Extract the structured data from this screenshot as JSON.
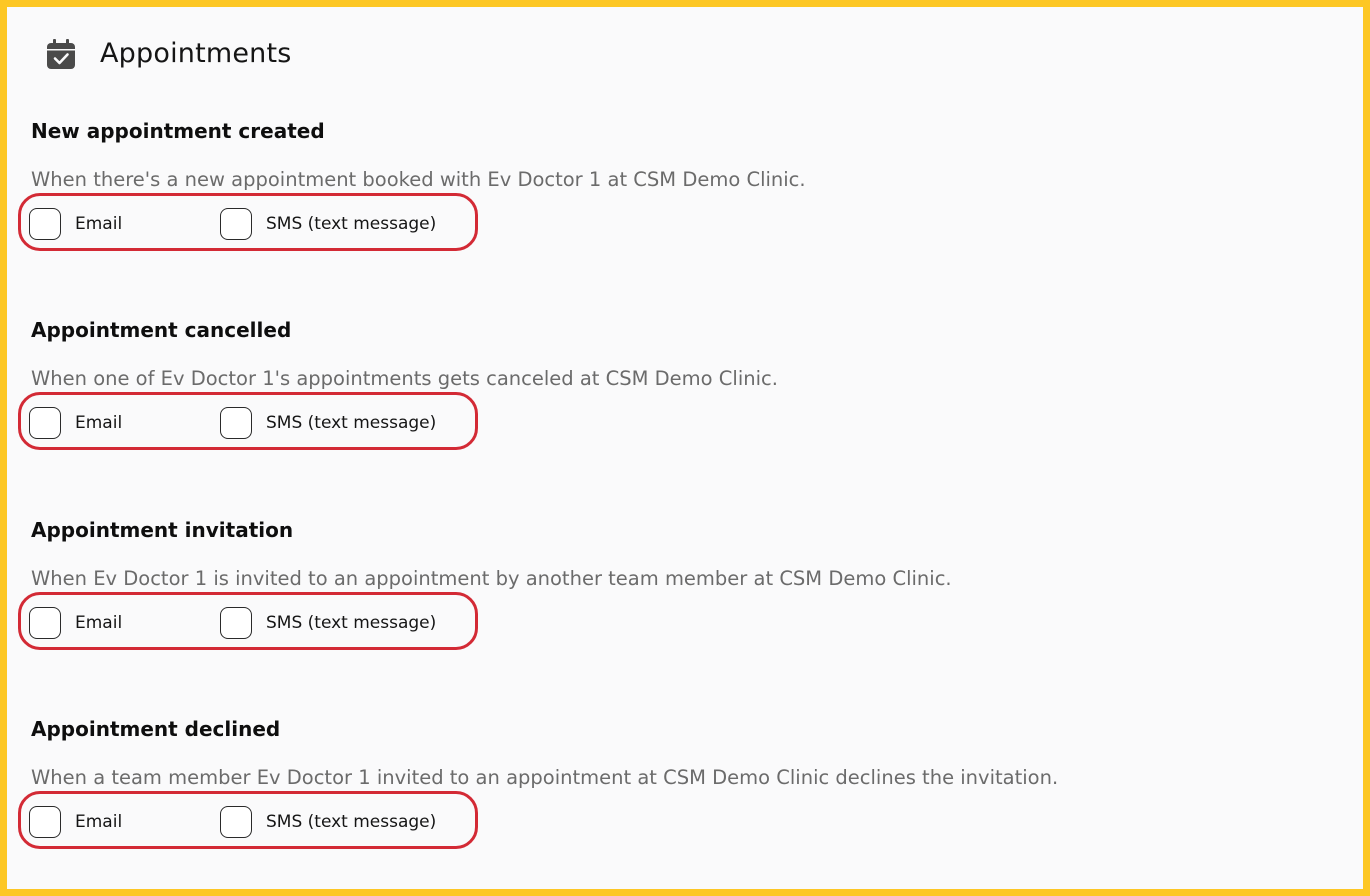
{
  "header": {
    "title": "Appointments",
    "icon": "calendar-check-icon"
  },
  "colors": {
    "frame_border": "#fdc725",
    "highlight_border": "#d32a35",
    "description_text": "#6b6b6b"
  },
  "sections": [
    {
      "title": "New appointment created",
      "description": "When there's a new appointment booked with Ev Doctor 1 at CSM Demo Clinic.",
      "email_label": "Email",
      "email_checked": false,
      "sms_label": "SMS (text message)",
      "sms_checked": false
    },
    {
      "title": "Appointment cancelled",
      "description": "When one of Ev Doctor 1's appointments gets canceled at CSM Demo Clinic.",
      "email_label": "Email",
      "email_checked": false,
      "sms_label": "SMS (text message)",
      "sms_checked": false
    },
    {
      "title": "Appointment invitation",
      "description": "When Ev Doctor 1 is invited to an appointment by another team member at CSM Demo Clinic.",
      "email_label": "Email",
      "email_checked": false,
      "sms_label": "SMS (text message)",
      "sms_checked": false
    },
    {
      "title": "Appointment declined",
      "description": "When a team member Ev Doctor 1 invited to an appointment at CSM Demo Clinic declines the invitation.",
      "email_label": "Email",
      "email_checked": false,
      "sms_label": "SMS (text message)",
      "sms_checked": false
    }
  ]
}
